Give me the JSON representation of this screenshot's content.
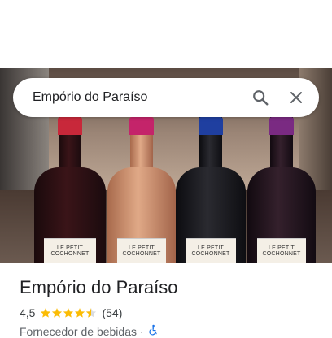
{
  "search": {
    "query": "Empório do Paraíso",
    "search_icon": "search-icon",
    "close_icon": "close-icon"
  },
  "photo": {
    "bottles": [
      {
        "label": "LE PETIT COCHONNET",
        "cap_color": "#c8283a"
      },
      {
        "label": "LE PETIT COCHONNET",
        "cap_color": "#c4246a"
      },
      {
        "label": "LE PETIT COCHONNET",
        "cap_color": "#1f3fa0"
      },
      {
        "label": "LE PETIT COCHONNET",
        "cap_color": "#7a2a82"
      }
    ]
  },
  "place": {
    "name": "Empório do Paraíso",
    "rating": "4,5",
    "rating_value": 4.5,
    "review_count": "(54)",
    "category": "Fornecedor de bebidas",
    "separator": "·",
    "accessibility_icon": "wheelchair-icon",
    "star_color": "#fbbc04"
  }
}
